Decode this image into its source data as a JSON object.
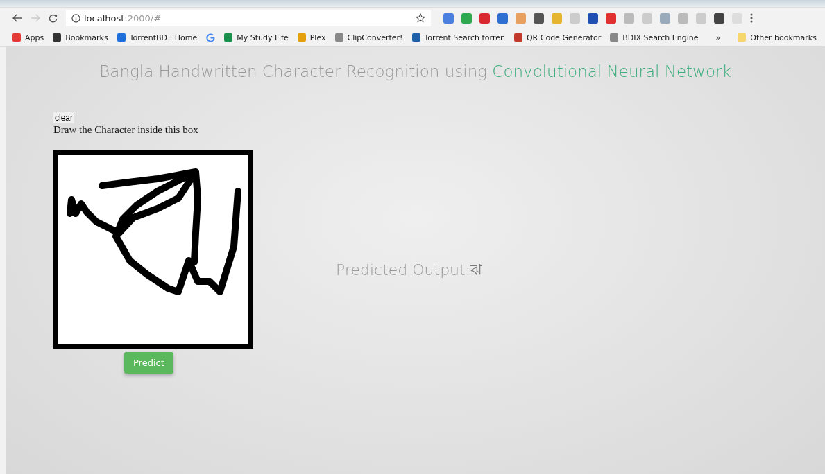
{
  "browser": {
    "url": {
      "host": "localhost",
      "path": ":2000/#"
    },
    "bookmarks": [
      {
        "label": "Apps"
      },
      {
        "label": "Bookmarks"
      },
      {
        "label": "TorrentBD : Home"
      },
      {
        "kind": "icon"
      },
      {
        "label": "My Study Life"
      },
      {
        "label": "Plex"
      },
      {
        "label": "ClipConverter!"
      },
      {
        "label": "Torrent Search torren"
      },
      {
        "label": "QR Code Generator"
      },
      {
        "label": "BDIX Search Engine"
      }
    ],
    "overflow": "»",
    "other_bookmarks": "Other bookmarks"
  },
  "page": {
    "title": {
      "text": "Bangla Handwritten Character Recognition using",
      "highlight": "Convolutional Neural Network"
    },
    "clear_button": "clear",
    "instruction": "Draw the Character inside this box",
    "predict_button": "Predict",
    "output": {
      "label": "Predicted Output:",
      "value": "ঝ"
    }
  }
}
